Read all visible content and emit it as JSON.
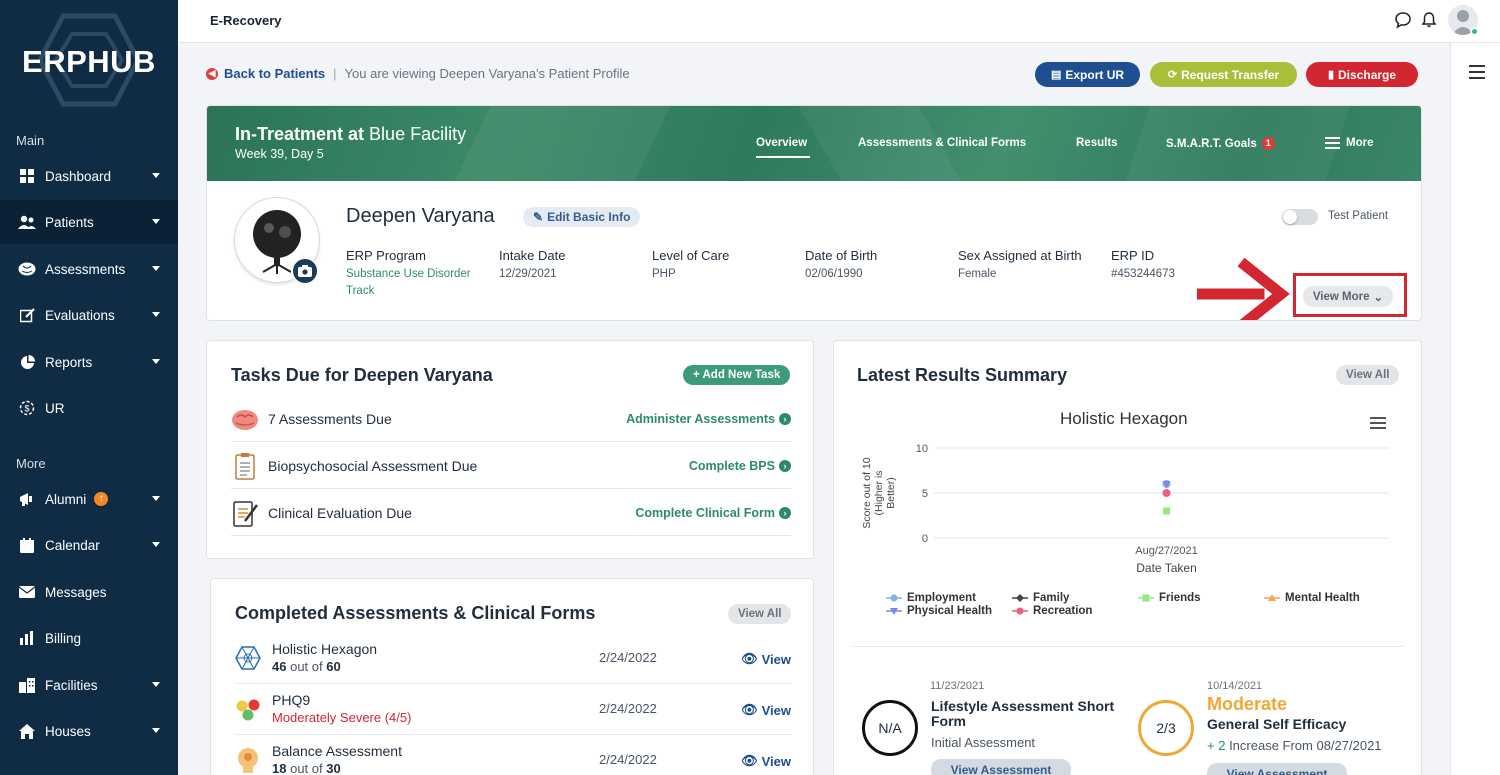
{
  "app": {
    "title": "E-Recovery",
    "brand": "ERPHUB"
  },
  "sidebar": {
    "section_main": "Main",
    "section_more": "More",
    "items": [
      {
        "label": "Dashboard",
        "icon": "dashboard-icon"
      },
      {
        "label": "Patients",
        "icon": "patients-icon"
      },
      {
        "label": "Assessments",
        "icon": "brain-icon"
      },
      {
        "label": "Evaluations",
        "icon": "edit-icon"
      },
      {
        "label": "Reports",
        "icon": "pie-chart-icon"
      },
      {
        "label": "UR",
        "icon": "ur-icon"
      }
    ],
    "more_items": [
      {
        "label": "Alumni",
        "icon": "megaphone-icon"
      },
      {
        "label": "Calendar",
        "icon": "calendar-icon"
      },
      {
        "label": "Messages",
        "icon": "envelope-icon"
      },
      {
        "label": "Billing",
        "icon": "bar-chart-icon"
      },
      {
        "label": "Facilities",
        "icon": "building-icon"
      },
      {
        "label": "Houses",
        "icon": "house-icon"
      }
    ]
  },
  "breadcrumb": {
    "back": "Back to Patients",
    "separator": "|",
    "viewing": "You are viewing Deepen Varyana's Patient Profile"
  },
  "actions": {
    "export": "Export UR",
    "transfer": "Request Transfer",
    "discharge": "Discharge"
  },
  "hero": {
    "status_bold": "In-Treatment at",
    "facility": "Blue Facility",
    "week": "Week 39, Day 5",
    "tabs": {
      "overview": "Overview",
      "assessments": "Assessments & Clinical Forms",
      "results": "Results",
      "smart": "S.M.A.R.T. Goals",
      "smart_badge": "1",
      "more": "More"
    }
  },
  "patient": {
    "name": "Deepen Varyana",
    "edit": "Edit Basic Info",
    "test_label": "Test Patient",
    "fields": {
      "program_label": "ERP Program",
      "program_value": "Substance Use Disorder Track",
      "intake_label": "Intake Date",
      "intake_value": "12/29/2021",
      "loc_label": "Level of Care",
      "loc_value": "PHP",
      "dob_label": "Date of Birth",
      "dob_value": "02/06/1990",
      "sex_label": "Sex Assigned at Birth",
      "sex_value": "Female",
      "erp_label": "ERP ID",
      "erp_value": "#453244673"
    },
    "view_more": "View More"
  },
  "tasks": {
    "title": "Tasks Due for Deepen Varyana",
    "add": "+ Add New Task",
    "rows": [
      {
        "label": "7 Assessments Due",
        "link": "Administer Assessments"
      },
      {
        "label": "Biopsychosocial Assessment Due",
        "link": "Complete BPS"
      },
      {
        "label": "Clinical Evaluation Due",
        "link": "Complete Clinical Form"
      }
    ]
  },
  "completed": {
    "title": "Completed Assessments & Clinical Forms",
    "view_all": "View All",
    "rows": [
      {
        "name": "Holistic Hexagon",
        "score_num": "46",
        "score_mid": "out of",
        "score_den": "60",
        "date": "2/24/2022",
        "view": "View"
      },
      {
        "name": "PHQ9",
        "status": "Moderately Severe (4/5)",
        "date": "2/24/2022",
        "view": "View"
      },
      {
        "name": "Balance Assessment",
        "score_num": "18",
        "score_mid": "out of",
        "score_den": "30",
        "date": "2/24/2022",
        "view": "View"
      }
    ]
  },
  "results": {
    "title": "Latest Results Summary",
    "view_all": "View All"
  },
  "chart_data": {
    "type": "scatter",
    "title": "Holistic Hexagon",
    "xlabel": "Date Taken",
    "ylabel": "Score out of 10 (Higher is Better)",
    "ylim": [
      0,
      10
    ],
    "yticks": [
      "0",
      "5",
      "10"
    ],
    "categories": [
      "Aug/27/2021"
    ],
    "grid": true,
    "legend_position": "bottom",
    "series": [
      {
        "name": "Employment",
        "values": [
          6
        ],
        "color": "#7cb5ec",
        "marker": "circle"
      },
      {
        "name": "Family",
        "values": [
          null
        ],
        "color": "#434348",
        "marker": "diamond"
      },
      {
        "name": "Friends",
        "values": [
          3
        ],
        "color": "#90ed7d",
        "marker": "square"
      },
      {
        "name": "Mental Health",
        "values": [
          null
        ],
        "color": "#f7a35c",
        "marker": "triangle"
      },
      {
        "name": "Physical Health",
        "values": [
          6
        ],
        "color": "#8085e9",
        "marker": "triangle-down"
      },
      {
        "name": "Recreation",
        "values": [
          5
        ],
        "color": "#f15c80",
        "marker": "circle"
      }
    ]
  },
  "summary": [
    {
      "circle": "N/A",
      "date": "11/23/2021",
      "title": "Lifestyle Assessment Short Form",
      "sub": "Initial Assessment",
      "button": "View Assessment"
    },
    {
      "circle": "2/3",
      "date": "10/14/2021",
      "level": "Moderate",
      "title": "General Self Efficacy",
      "delta": "+ 2",
      "sub": "Increase From 08/27/2021",
      "button": "View Assessment"
    }
  ],
  "colors": {
    "sidebar": "#0f2c44",
    "green": "#2e8b6a",
    "export": "#1d4f91",
    "transfer": "#a8bf3a",
    "discharge": "#d22630",
    "moderate": "#f0a833"
  }
}
